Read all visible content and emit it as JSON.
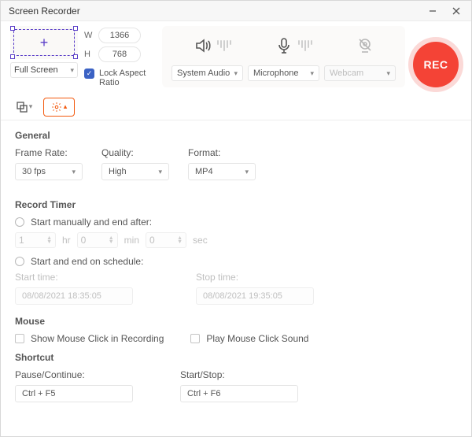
{
  "window": {
    "title": "Screen Recorder"
  },
  "capture": {
    "mode": "Full Screen",
    "width": "1366",
    "height": "768",
    "lock_label": "Lock Aspect Ratio",
    "locked": true
  },
  "sources": {
    "audio": {
      "label": "System Audio"
    },
    "mic": {
      "label": "Microphone"
    },
    "cam": {
      "label": "Webcam",
      "enabled": false
    }
  },
  "rec_label": "REC",
  "settings": {
    "general": {
      "title": "General",
      "frame_rate": {
        "label": "Frame Rate:",
        "value": "30 fps"
      },
      "quality": {
        "label": "Quality:",
        "value": "High"
      },
      "format": {
        "label": "Format:",
        "value": "MP4"
      }
    },
    "timer": {
      "title": "Record Timer",
      "opt_after": "Start manually and end after:",
      "hr": "1",
      "min": "0",
      "sec": "0",
      "u_hr": "hr",
      "u_min": "min",
      "u_sec": "sec",
      "opt_sched": "Start and end on schedule:",
      "start_label": "Start time:",
      "stop_label": "Stop time:",
      "start_value": "08/08/2021 18:35:05",
      "stop_value": "08/08/2021 19:35:05"
    },
    "mouse": {
      "title": "Mouse",
      "show_click": "Show Mouse Click in Recording",
      "play_sound": "Play Mouse Click Sound"
    },
    "shortcut": {
      "title": "Shortcut",
      "pause_label": "Pause/Continue:",
      "pause_value": "Ctrl + F5",
      "start_label": "Start/Stop:",
      "start_value": "Ctrl + F6"
    }
  }
}
